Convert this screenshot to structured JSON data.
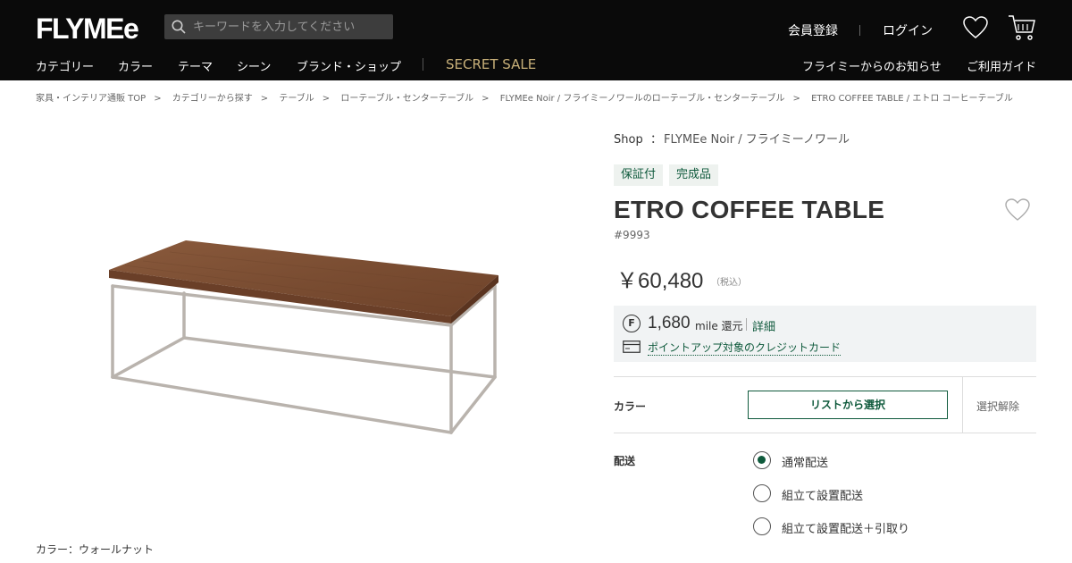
{
  "header": {
    "logo": "FLYMEe",
    "search_placeholder": "キーワードを入力してください",
    "register": "会員登録",
    "login": "ログイン",
    "nav": [
      "カテゴリー",
      "カラー",
      "テーマ",
      "シーン",
      "ブランド・ショップ"
    ],
    "secret_sale": "SECRET SALE",
    "news": "フライミーからのお知らせ",
    "guide": "ご利用ガイド",
    "accent_color": "#c8b079"
  },
  "breadcrumb": [
    "家具・インテリア通販 TOP",
    "カテゴリーから探す",
    "テーブル",
    "ローテーブル・センターテーブル",
    "FLYMEe Noir / フライミーノワールのローテーブル・センターテーブル",
    "ETRO COFFEE TABLE / エトロ コーヒーテーブル"
  ],
  "gallery": {
    "color_caption": "カラー：ウォールナット"
  },
  "product": {
    "shop_label": "Shop",
    "shop_colon": "：",
    "shop_name": "FLYMEe Noir / フライミーノワール",
    "tags": [
      "保証付",
      "完成品"
    ],
    "title": "ETRO COFFEE TABLE",
    "sku": "#9993",
    "price": "￥60,480",
    "tax_note": "（税込）",
    "mile_icon": "F",
    "mile_amount": "1,680",
    "mile_unit": "mile 還元",
    "mile_detail": "詳細",
    "credit_card_link": "ポイントアップ対象のクレジットカード",
    "brand_color": "#0f5a3c"
  },
  "options": {
    "color_label": "カラー",
    "select_button": "リストから選択",
    "clear_button": "選択解除",
    "delivery_label": "配送",
    "delivery_options": [
      {
        "label": "通常配送",
        "selected": true
      },
      {
        "label": "組立て設置配送",
        "selected": false
      },
      {
        "label": "組立て設置配送＋引取り",
        "selected": false
      }
    ]
  }
}
